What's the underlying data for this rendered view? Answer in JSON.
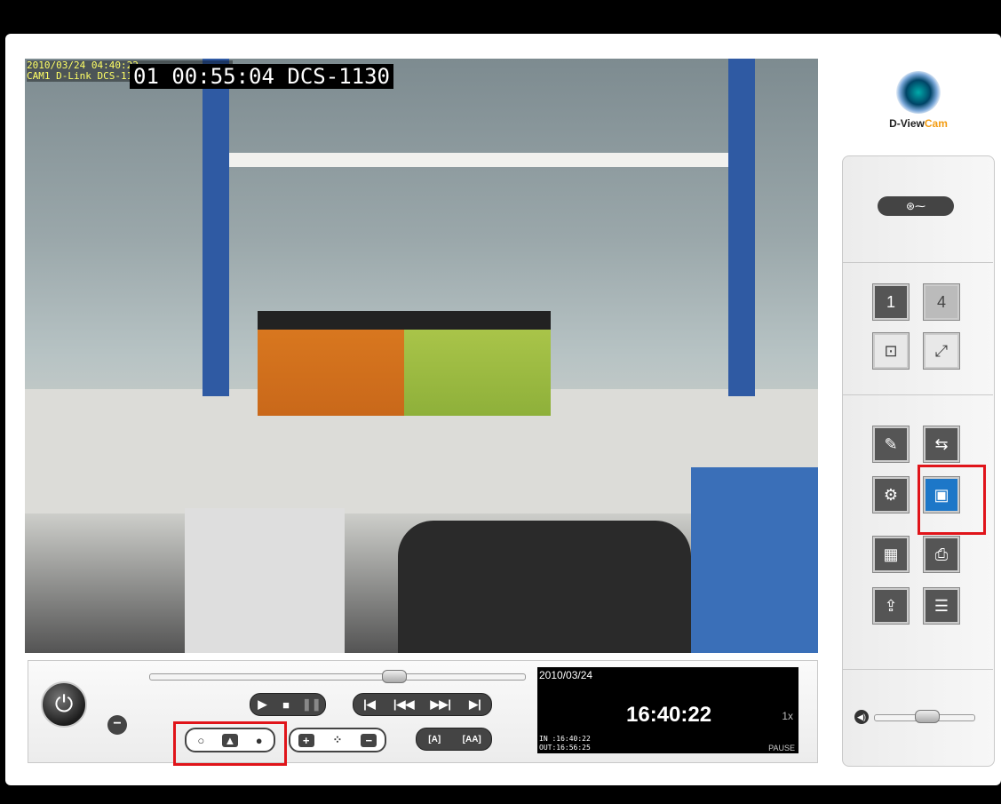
{
  "video": {
    "osd_line1": "2010/03/24 04:40:22",
    "osd_line2": "CAM1 D-Link DCS-1130 (192.168.1.20)",
    "osd_big": "01 00:55:04 DCS-1130"
  },
  "playback": {
    "power_icon": "power-icon",
    "zoom_out_label": "−",
    "play_label": "▶",
    "stop_label": "■",
    "pause_label": "❚❚",
    "first_label": "|◀",
    "prev_label": "|◀◀",
    "next_label": "▶▶|",
    "last_label": "▶|",
    "mark_in_label": "○",
    "mark_mid_label": "▲",
    "mark_out_label": "●",
    "speed_up_label": "+",
    "speed_icon_label": "⁘",
    "speed_down_label": "−",
    "mark_a_label": "[A]",
    "mark_b_label": "[AA]"
  },
  "time_panel": {
    "date": "2010/03/24",
    "time": "16:40:22",
    "speed": "1x",
    "in": "IN :16:40:22",
    "out": "OUT:16:56:25",
    "status": "PAUSE"
  },
  "logo": {
    "text_main": "D-View",
    "text_accent": "Cam"
  },
  "side": {
    "sequence_label": "⊛⁓",
    "layout1_label": "1",
    "layout4_label": "4",
    "center_label": "⊡",
    "fullscreen_label": "⤢",
    "edit_label": "✎",
    "export_label": "⇆",
    "settings_label": "⚙",
    "save_video_label": "▣",
    "snapshot_label": "▦",
    "print_label": "⎙",
    "backup_label": "⇪",
    "list_label": "☰"
  },
  "colors": {
    "highlight": "#e0141a",
    "selected_button": "#1d77c8"
  }
}
